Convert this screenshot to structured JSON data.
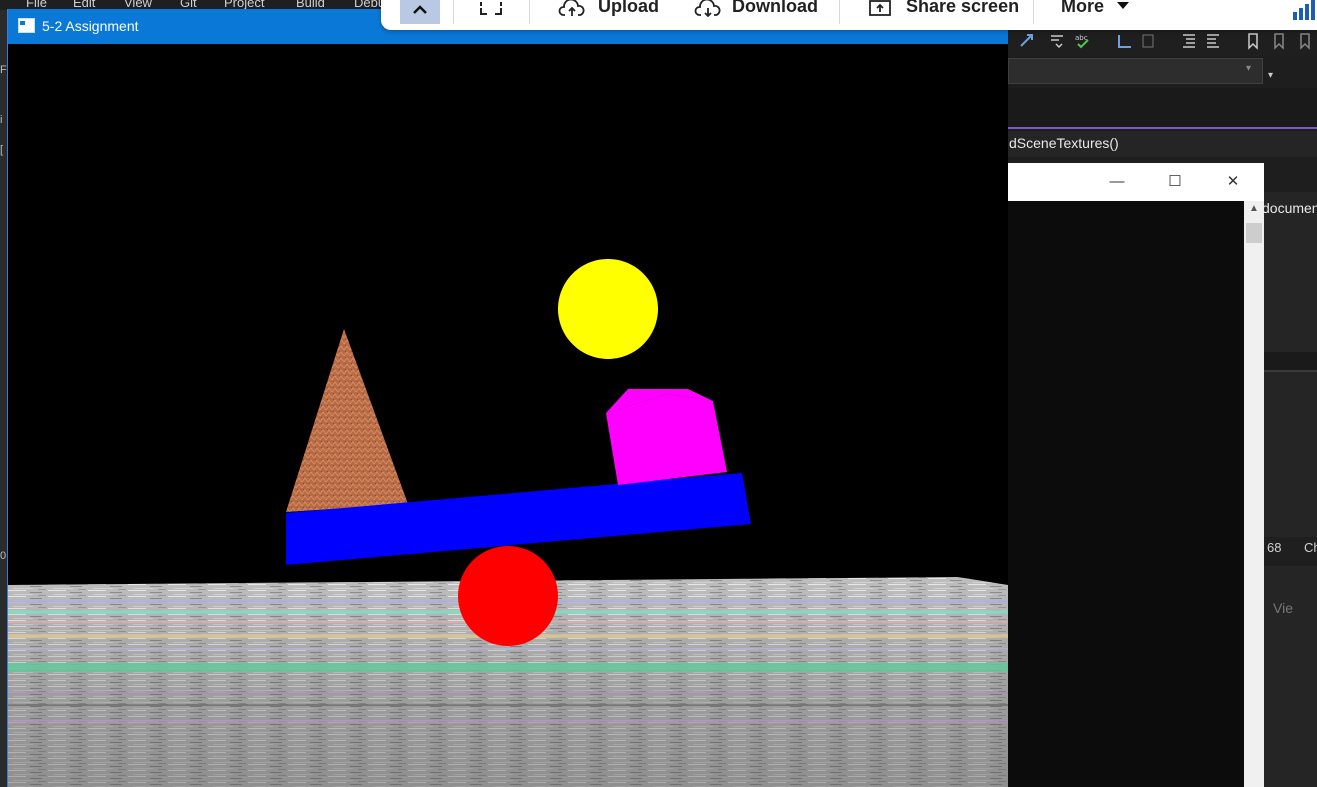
{
  "ide": {
    "menu": [
      "File",
      "Edit",
      "View",
      "Git",
      "Project",
      "Build",
      "Debu"
    ],
    "func_tab_label": "dSceneTextures()",
    "doc_tab_label": "documen",
    "status_number": "68",
    "status_ch": "Ch",
    "view_label": "Vie",
    "accent_color": "#7b5cc6"
  },
  "meeting_toolbar": {
    "upload": "Upload",
    "download": "Download",
    "share_screen": "Share screen",
    "more": "More",
    "collapse_icon": "chevron-up-icon",
    "fullscreen_icon": "fullscreen-icon"
  },
  "gl_window": {
    "title": "5-2 Assignment",
    "titlebar_color": "#0a78d7",
    "scene": {
      "background": "#000000",
      "pyramid_color": "#b86a44",
      "plank_color": "#0000ff",
      "sphere_bottom_color": "#ff0000",
      "cube_color": "#ff00ff",
      "sphere_top_color": "#ffff00"
    }
  },
  "console_window": {
    "minimize_icon": "minimize-icon",
    "maximize_icon": "maximize-icon",
    "close_icon": "close-icon"
  }
}
